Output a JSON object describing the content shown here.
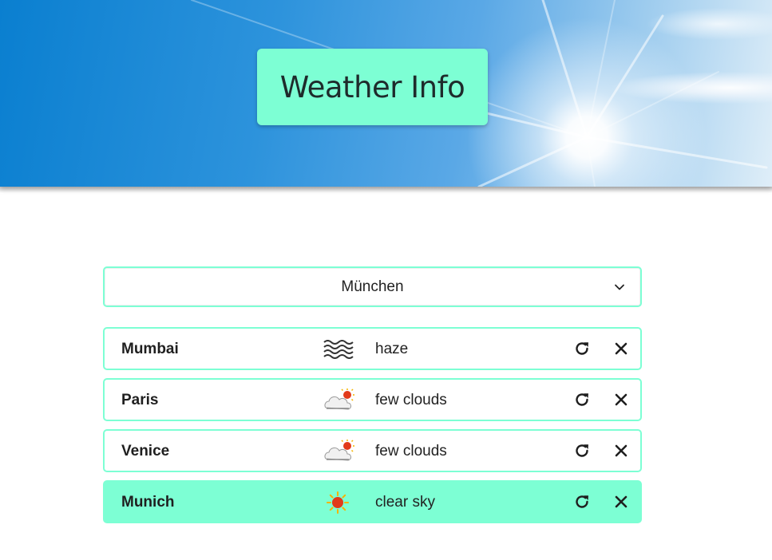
{
  "header": {
    "title": "Weather Info",
    "accent_color": "#7dffd4"
  },
  "city_select": {
    "selected": "München",
    "icon": "chevron-down-icon"
  },
  "weather_list": [
    {
      "city": "Mumbai",
      "icon": "haze-icon",
      "description": "haze",
      "active": false
    },
    {
      "city": "Paris",
      "icon": "few-clouds-icon",
      "description": "few clouds",
      "active": false
    },
    {
      "city": "Venice",
      "icon": "few-clouds-icon",
      "description": "few clouds",
      "active": false
    },
    {
      "city": "Munich",
      "icon": "clear-sky-icon",
      "description": "clear sky",
      "active": true
    }
  ],
  "actions": {
    "refresh_icon": "refresh-icon",
    "close_icon": "close-icon"
  }
}
